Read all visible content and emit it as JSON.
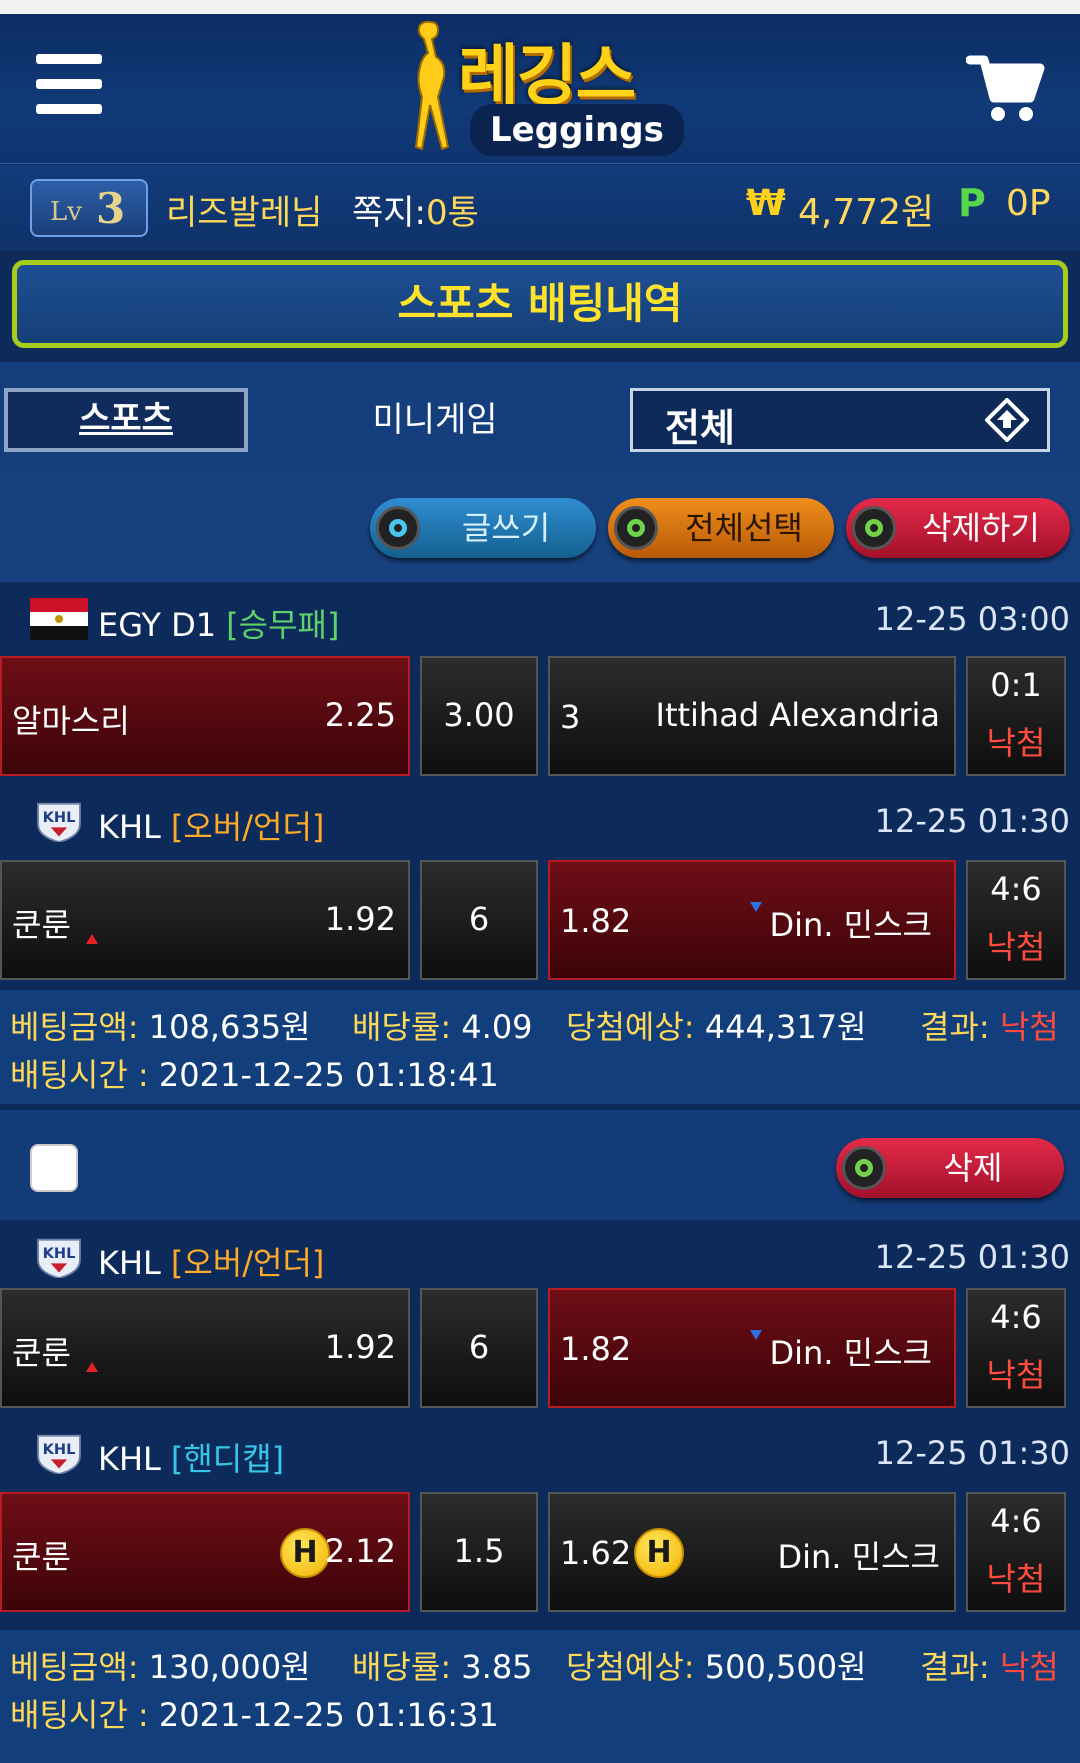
{
  "header": {
    "logo_kr": "레깅스",
    "logo_en": "Leggings",
    "menu_icon": "hamburger-menu-icon",
    "cart_icon": "shopping-cart-icon"
  },
  "user": {
    "level_prefix": "Lv",
    "level": "3",
    "name": "리즈발레님",
    "memo_label": "쪽지:",
    "memo_count": "0통",
    "won_symbol": "₩",
    "balance": "4,772원",
    "points_symbol": "P",
    "points": "0P"
  },
  "page_title": "스포츠 배팅내역",
  "tabs": {
    "sports": "스포츠",
    "minigame": "미니게임",
    "filter_value": "전체"
  },
  "actions": {
    "write": "글쓰기",
    "select_all": "전체선택",
    "delete": "삭제하기"
  },
  "bet1": {
    "matches": [
      {
        "league": "EGY D1",
        "type": "[승무패]",
        "time": "12-25 03:00",
        "home": "알마스리",
        "home_odd": "2.25",
        "mid": "3.00",
        "away_odd": "3",
        "away": "Ittihad Alexandria",
        "score": "0:1",
        "result": "낙첨"
      },
      {
        "league": "KHL",
        "type": "[오버/언더]",
        "time": "12-25 01:30",
        "home": "쿤룬",
        "home_odd": "1.92",
        "mid": "6",
        "away_odd": "1.82",
        "away": "Din. 민스크",
        "score": "4:6",
        "result": "낙첨"
      }
    ],
    "summary": {
      "amount_label": "베팅금액:",
      "amount": "108,635원",
      "rate_label": "배당률:",
      "rate": "4.09",
      "expected_label": "당첨예상:",
      "expected": "444,317원",
      "result_label": "결과:",
      "result": "낙첨",
      "time_label": "배팅시간 :",
      "time": "2021-12-25 01:18:41"
    }
  },
  "bet2": {
    "delete_label": "삭제",
    "matches": [
      {
        "league": "KHL",
        "type": "[오버/언더]",
        "time": "12-25 01:30",
        "home": "쿤룬",
        "home_odd": "1.92",
        "mid": "6",
        "away_odd": "1.82",
        "away": "Din. 민스크",
        "score": "4:6",
        "result": "낙첨"
      },
      {
        "league": "KHL",
        "type": "[핸디캡]",
        "time": "12-25 01:30",
        "home": "쿤룬",
        "home_odd": "2.12",
        "mid": "1.5",
        "away_odd": "1.62",
        "away": "Din. 민스크",
        "score": "4:6",
        "result": "낙첨",
        "handicap_badge": "H"
      }
    ],
    "summary": {
      "amount_label": "베팅금액:",
      "amount": "130,000원",
      "rate_label": "배당률:",
      "rate": "3.85",
      "expected_label": "당첨예상:",
      "expected": "500,500원",
      "result_label": "결과:",
      "result": "낙첨",
      "time_label": "배팅시간 :",
      "time": "2021-12-25 01:16:31"
    }
  },
  "colors": {
    "accent_yellow": "#ffd85a",
    "result_red": "#ff4a3e",
    "title_border": "#a8cc1e"
  }
}
